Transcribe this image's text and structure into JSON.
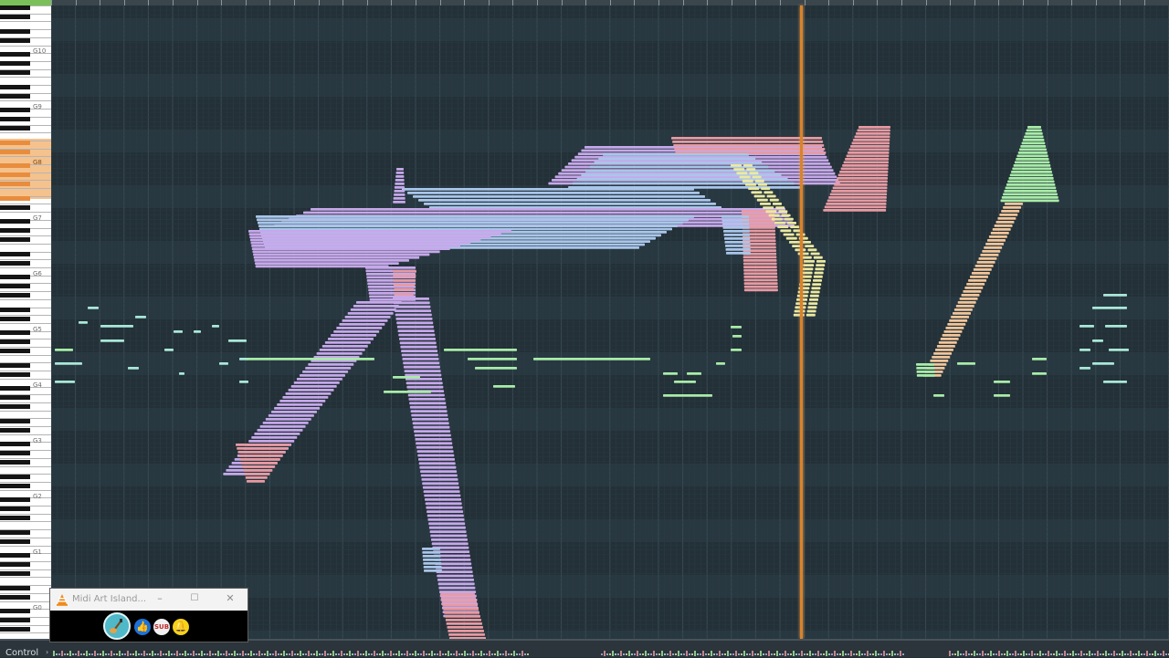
{
  "piano": {
    "octave_labels": [
      "G10",
      "G9",
      "G8",
      "G7",
      "G6",
      "G5",
      "G4",
      "G3",
      "G2",
      "G1",
      "G0"
    ],
    "highlighted_octave": "G8"
  },
  "control": {
    "label": "Control",
    "arrow": "›"
  },
  "popup": {
    "title": "Midi Art Island...",
    "minimize": "–",
    "maximize": "☐",
    "close": "✕",
    "icons": [
      "channel-avatar-icon",
      "like-icon",
      "subscribe-icon",
      "bell-icon"
    ],
    "subscribe_text": "SUB"
  },
  "colors": {
    "background": "#233037",
    "playhead": "#d8832c",
    "note_lavender": "#c6a8ea",
    "note_blue": "#a9c6ea",
    "note_pink": "#e79aa2",
    "note_green": "#a8eca8",
    "note_yellow": "#ece9a1",
    "note_orange": "#f1c59a",
    "note_cyan": "#a9e8d8"
  }
}
